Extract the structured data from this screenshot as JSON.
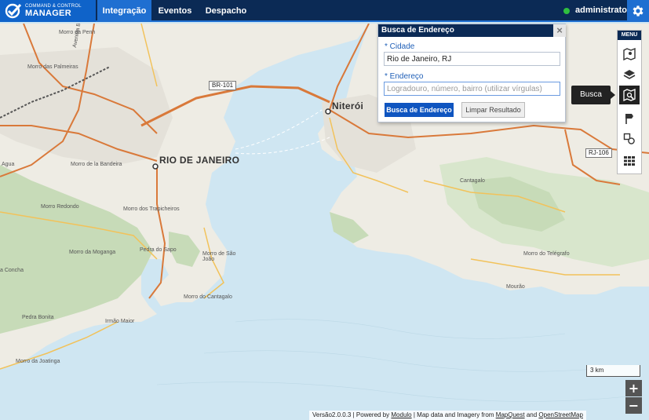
{
  "app": {
    "logo_line1": "COMMAND & CONTROL",
    "logo_line2": "MANAGER",
    "tabs": [
      {
        "label": "Integração",
        "active": true
      },
      {
        "label": "Eventos",
        "active": false
      },
      {
        "label": "Despacho",
        "active": false
      }
    ],
    "user": "administrator",
    "status_color": "#2fbf3f",
    "accent_color": "#1f6fd1",
    "navbar_color": "#0b2a55"
  },
  "search_panel": {
    "title": "Busca de Endereço",
    "city_label": "* Cidade",
    "city_value": "Rio de Janeiro, RJ",
    "address_label": "* Endereço",
    "address_value": "",
    "address_placeholder": "Logradouro, número, bairro (utilizar vírgulas)",
    "search_button": "Busca de Endereço",
    "clear_button": "Limpar Resultado",
    "close_icon": "close-icon"
  },
  "menu": {
    "title": "MENU",
    "tools": [
      {
        "name": "map-layers-icon",
        "active": false
      },
      {
        "name": "stack-layers-icon",
        "active": false
      },
      {
        "name": "address-search-icon",
        "active": true
      },
      {
        "name": "map-pin-icon",
        "active": false
      },
      {
        "name": "shapes-icon",
        "active": false
      },
      {
        "name": "grid-icon",
        "active": false
      }
    ],
    "tooltip": "Busca"
  },
  "map": {
    "labels": {
      "rio": "RIO DE JANEIRO",
      "niteroi": "Niterói",
      "br101": "BR-101",
      "rj106": "RJ-106",
      "morro_penha": "Morro da Penh",
      "morro_palmeiras": "Morro das Palmeiras",
      "avenida_brasil": "Avenida Brasil",
      "morro_bandeira": "Morro de la Bandeira",
      "agua": "Agua",
      "morro_redondo": "Morro Redondo",
      "morro_trapicheiros": "Morro dos Trapicheiros",
      "morro_moganga": "Morro da Moganga",
      "pedra_sapo": "Pedra do Sapo",
      "morro_sao_joao": "Morro de São João",
      "morro_cantagalo": "Morro do Cantagalo",
      "concha": "a Concha",
      "pedra_bonita": "Pedra Bonita",
      "irmao_maior": "Irmão Maior",
      "morro_joatinga": "Morro da Joatinga",
      "cantagalo": "Cantagalo",
      "morro_telegrafo": "Morro do Telégrafo",
      "mourao": "Mourão"
    },
    "scale": "3 km",
    "zoom_in": "+",
    "zoom_out": "−",
    "water_color": "#cfe6f2",
    "land_color": "#eeece4",
    "park_color": "#c7dbb8"
  },
  "footer": {
    "version": "Versão2.0.0.3",
    "powered": "| Powered by",
    "modulo": "Modulo",
    "mapdata": "| Map data and Imagery from",
    "mapquest": "MapQuest",
    "and": "and",
    "osm": "OpenStreetMap"
  }
}
